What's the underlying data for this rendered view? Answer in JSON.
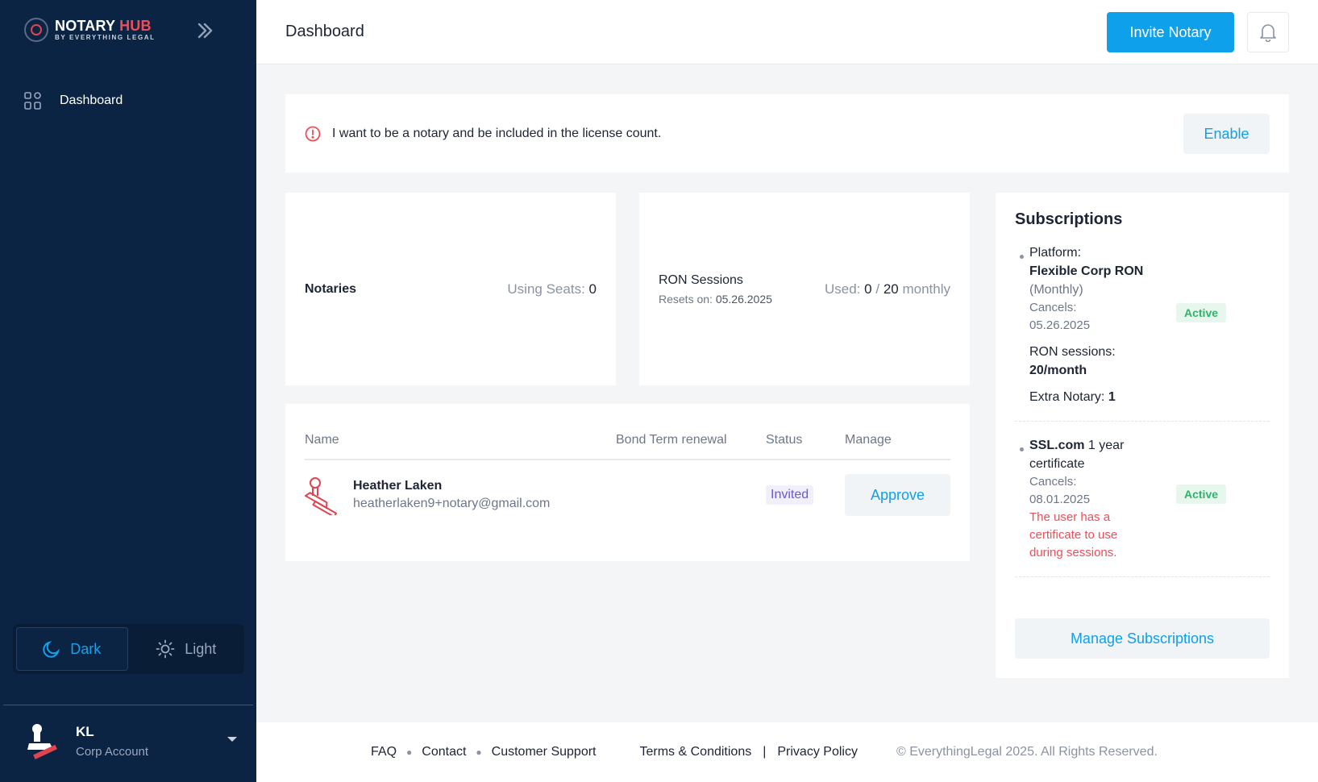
{
  "brand": {
    "name_part1": "NOTARY",
    "name_part2": "HUB",
    "tagline": "BY EVERYTHING LEGAL",
    "accent": "#ef4d58",
    "primary": "#0ea0ea",
    "sidebar_bg": "#0c2444"
  },
  "sidebar": {
    "nav": [
      {
        "label": "Dashboard",
        "icon": "grid-icon"
      }
    ],
    "theme": {
      "dark_label": "Dark",
      "light_label": "Light",
      "selected": "Dark"
    },
    "account": {
      "initials": "KL",
      "type": "Corp Account"
    }
  },
  "header": {
    "title": "Dashboard",
    "invite_label": "Invite Notary"
  },
  "alert": {
    "text": "I want to be a notary and be included in the license count.",
    "button": "Enable"
  },
  "stats": {
    "notaries": {
      "label": "Notaries",
      "value_prefix": "Using Seats:",
      "value": "0"
    },
    "ron": {
      "label": "RON Sessions",
      "resets_label": "Resets on:",
      "resets_date": "05.26.2025",
      "used_prefix": "Used:",
      "used": "0",
      "sep": "/",
      "limit": "20",
      "period": "monthly"
    }
  },
  "table": {
    "columns": [
      "Name",
      "Bond Term renewal",
      "Status",
      "Manage"
    ],
    "rows": [
      {
        "name": "Heather Laken",
        "email": "heatherlaken9+notary@gmail.com",
        "bond": "",
        "status": "Invited",
        "action": "Approve"
      }
    ]
  },
  "subscriptions": {
    "title": "Subscriptions",
    "items": [
      {
        "platform_label": "Platform:",
        "plan_bold": "Flexible Corp RON",
        "plan_period": "(Monthly)",
        "cancels_label": "Cancels:",
        "cancels_date": "05.26.2025",
        "sessions_label": "RON sessions:",
        "sessions_value": "20/month",
        "extra_label": "Extra Notary:",
        "extra_value": "1",
        "status": "Active"
      },
      {
        "product_bold": "SSL.com",
        "product_rest": "1 year certificate",
        "cancels_label": "Cancels:",
        "cancels_date": "08.01.2025",
        "note": "The user has a certificate to use during sessions.",
        "status": "Active"
      }
    ],
    "manage_label": "Manage Subscriptions"
  },
  "footer": {
    "links": [
      "FAQ",
      "Contact",
      "Customer Support"
    ],
    "legal": [
      "Terms & Conditions",
      "Privacy Policy"
    ],
    "separator": "|",
    "copyright": "© EverythingLegal 2025. All Rights Reserved."
  }
}
